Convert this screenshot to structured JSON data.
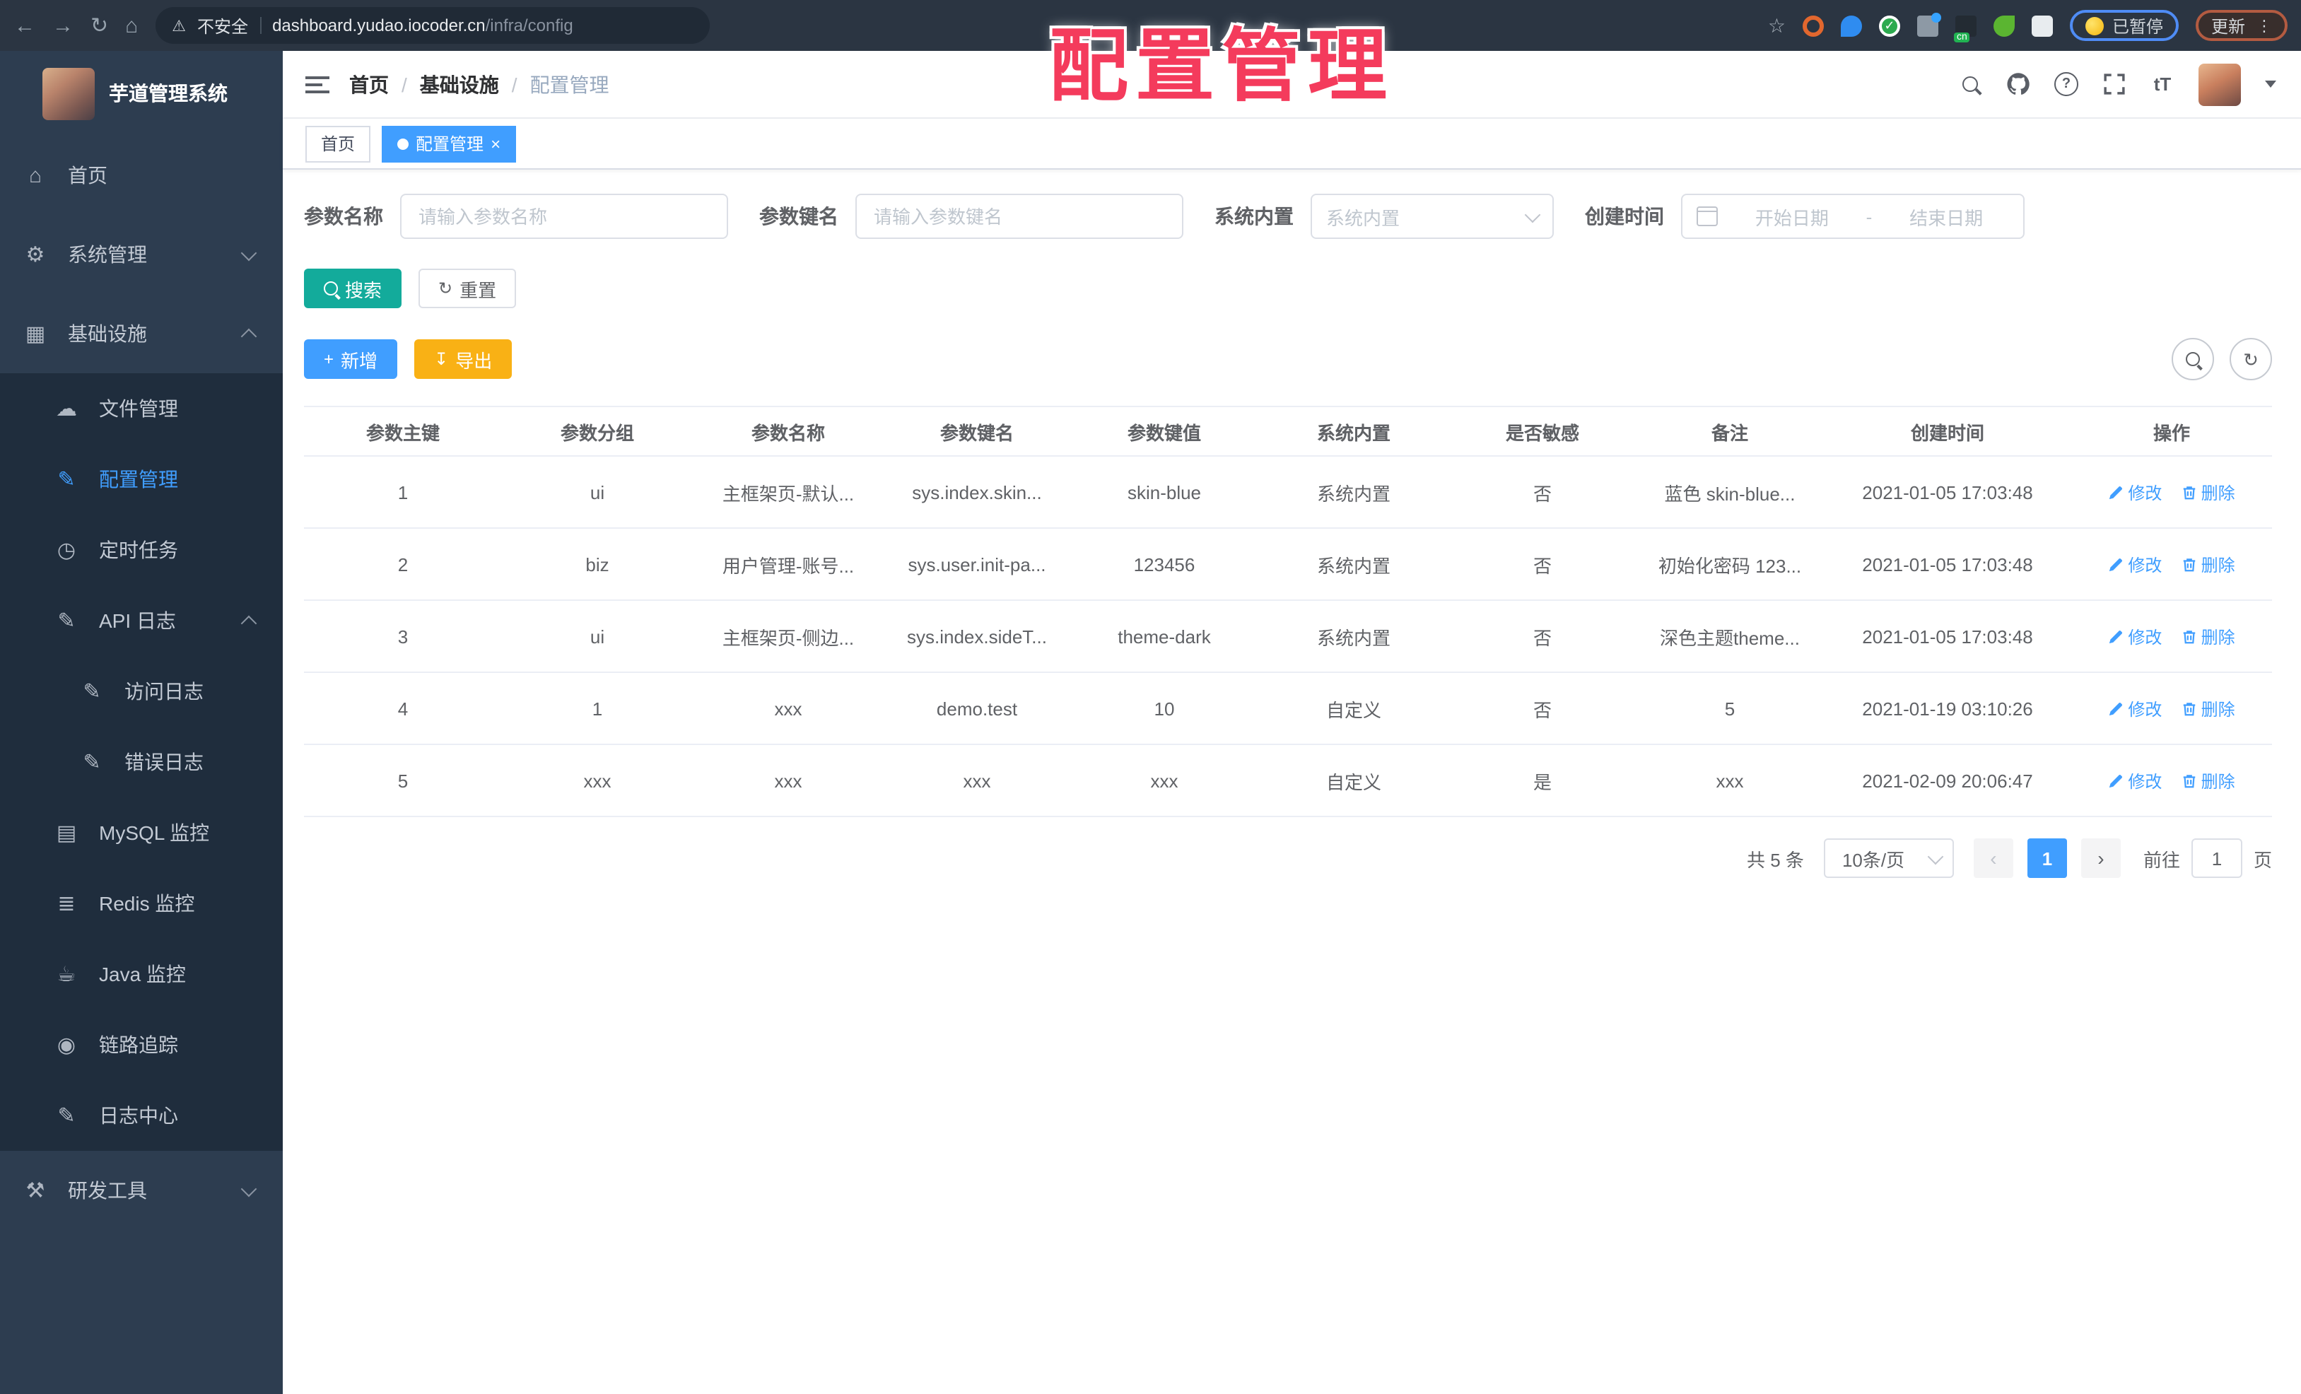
{
  "overlay": {
    "title": "配置管理"
  },
  "browser": {
    "security_label": "不安全",
    "url_host": "dashboard.yudao.iocoder.cn",
    "url_path": "/infra/config",
    "paused_badge": "已暂停",
    "update_button": "更新",
    "menu_dots": "⋮",
    "cn_badge": "cn",
    "back": "←",
    "forward": "→",
    "reload": "↻",
    "home": "⌂",
    "star": "☆",
    "warning": "⚠"
  },
  "sidebar": {
    "app_title": "芋道管理系统",
    "items": [
      {
        "label": "首页",
        "icon": "home"
      },
      {
        "label": "系统管理",
        "icon": "gear",
        "state": "collapsed"
      },
      {
        "label": "基础设施",
        "icon": "infrastructure",
        "state": "expanded"
      },
      {
        "label": "文件管理",
        "icon": "cloud"
      },
      {
        "label": "配置管理",
        "icon": "edit",
        "active": true
      },
      {
        "label": "定时任务",
        "icon": "clock"
      },
      {
        "label": "API 日志",
        "icon": "log",
        "state": "expanded"
      },
      {
        "label": "访问日志",
        "icon": "log"
      },
      {
        "label": "错误日志",
        "icon": "log"
      },
      {
        "label": "MySQL 监控",
        "icon": "mysql"
      },
      {
        "label": "Redis 监控",
        "icon": "redis"
      },
      {
        "label": "Java 监控",
        "icon": "java"
      },
      {
        "label": "链路追踪",
        "icon": "trace"
      },
      {
        "label": "日志中心",
        "icon": "log"
      },
      {
        "label": "研发工具",
        "icon": "tools",
        "state": "collapsed"
      }
    ]
  },
  "navbar": {
    "breadcrumb": [
      "首页",
      "基础设施",
      "配置管理"
    ],
    "font_button": "tT"
  },
  "tags": {
    "home": "首页",
    "current": "配置管理",
    "close": "×"
  },
  "filters": {
    "name_label": "参数名称",
    "name_placeholder": "请输入参数名称",
    "key_label": "参数键名",
    "key_placeholder": "请输入参数键名",
    "builtin_label": "系统内置",
    "builtin_placeholder": "系统内置",
    "created_label": "创建时间",
    "date_start": "开始日期",
    "date_sep": "-",
    "date_end": "结束日期",
    "search": "搜索",
    "reset": "重置"
  },
  "toolbar": {
    "add": "新增",
    "export": "导出"
  },
  "table": {
    "columns": [
      "参数主键",
      "参数分组",
      "参数名称",
      "参数键名",
      "参数键值",
      "系统内置",
      "是否敏感",
      "备注",
      "创建时间",
      "操作"
    ],
    "actions": {
      "edit": "修改",
      "delete": "删除"
    },
    "rows": [
      {
        "id": "1",
        "group": "ui",
        "name": "主框架页-默认...",
        "key": "sys.index.skin...",
        "value": "skin-blue",
        "builtin": "系统内置",
        "sensitive": "否",
        "remark": "蓝色 skin-blue...",
        "created": "2021-01-05 17:03:48"
      },
      {
        "id": "2",
        "group": "biz",
        "name": "用户管理-账号...",
        "key": "sys.user.init-pa...",
        "value": "123456",
        "builtin": "系统内置",
        "sensitive": "否",
        "remark": "初始化密码 123...",
        "created": "2021-01-05 17:03:48"
      },
      {
        "id": "3",
        "group": "ui",
        "name": "主框架页-侧边...",
        "key": "sys.index.sideT...",
        "value": "theme-dark",
        "builtin": "系统内置",
        "sensitive": "否",
        "remark": "深色主题theme...",
        "created": "2021-01-05 17:03:48"
      },
      {
        "id": "4",
        "group": "1",
        "name": "xxx",
        "key": "demo.test",
        "value": "10",
        "builtin": "自定义",
        "sensitive": "否",
        "remark": "5",
        "created": "2021-01-19 03:10:26"
      },
      {
        "id": "5",
        "group": "xxx",
        "name": "xxx",
        "key": "xxx",
        "value": "xxx",
        "builtin": "自定义",
        "sensitive": "是",
        "remark": "xxx",
        "created": "2021-02-09 20:06:47"
      }
    ]
  },
  "pagination": {
    "total": "共 5 条",
    "page_size": "10条/页",
    "prev": "‹",
    "next": "›",
    "current": "1",
    "goto_label": "前往",
    "goto_value": "1",
    "page_unit": "页"
  },
  "colors": {
    "accent": "#409eff",
    "search_button": "#13ab9b",
    "export_button": "#f9b115",
    "sidebar_bg": "#2d3d50",
    "submenu_bg": "#1f2d3d",
    "overlay_title": "#f43b5c",
    "chrome_bg": "#2b3542"
  }
}
